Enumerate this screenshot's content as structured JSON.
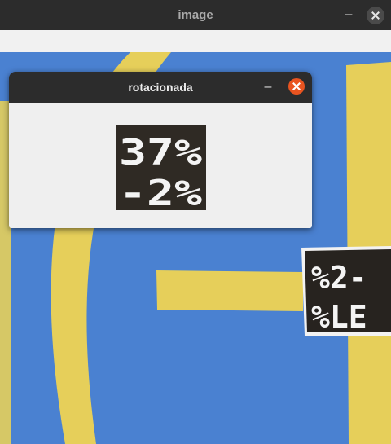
{
  "outer_window": {
    "title": "image",
    "minimize_glyph": "–"
  },
  "inner_window": {
    "title": "rotacionada",
    "minimize_glyph": "–",
    "display": {
      "line1": "37%",
      "line2": "-2%"
    }
  },
  "background_display": {
    "line1": "%2-",
    "line2": "%LE"
  },
  "colors": {
    "titlebar": "#2c2c2c",
    "close_accent": "#e95420",
    "canvas_blue": "#4f86d6",
    "stripe_yellow": "#e6cf5a"
  }
}
